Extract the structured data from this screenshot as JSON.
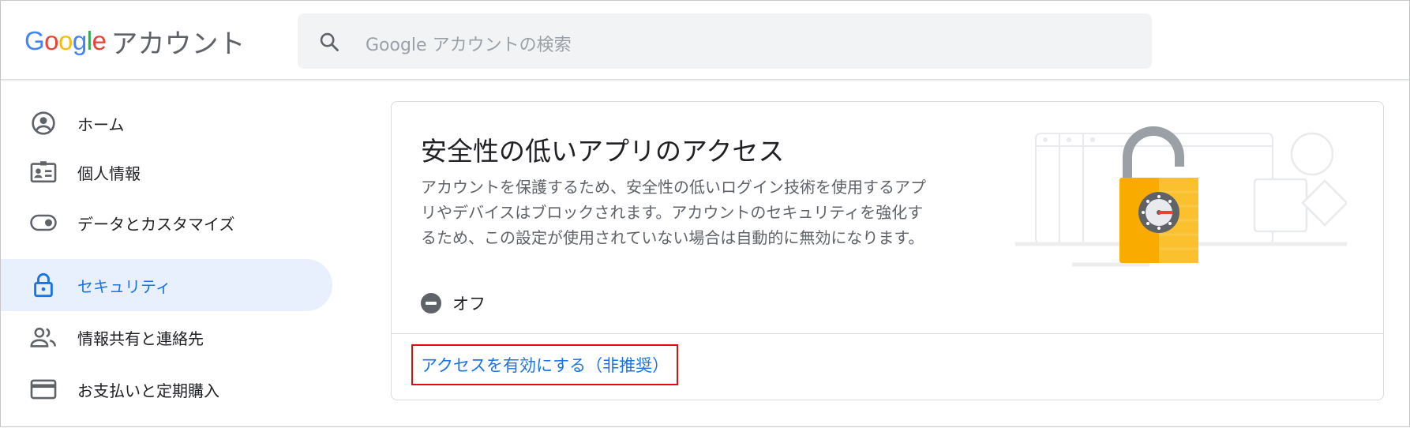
{
  "header": {
    "logo_letters": [
      {
        "char": "G",
        "color": "#4285F4"
      },
      {
        "char": "o",
        "color": "#EA4335"
      },
      {
        "char": "o",
        "color": "#FBBC05"
      },
      {
        "char": "g",
        "color": "#4285F4"
      },
      {
        "char": "l",
        "color": "#34A853"
      },
      {
        "char": "e",
        "color": "#EA4335"
      }
    ],
    "logo_google": "Google",
    "product_name": "アカウント",
    "search_placeholder": "Google アカウントの検索",
    "search_icon": "search-icon"
  },
  "sidebar": {
    "items": [
      {
        "label": "ホーム",
        "icon": "account-circle-icon",
        "active": false
      },
      {
        "label": "個人情報",
        "icon": "id-card-icon",
        "active": false
      },
      {
        "label": "データとカスタマイズ",
        "icon": "toggle-icon",
        "active": false
      },
      {
        "label": "セキュリティ",
        "icon": "lock-icon",
        "active": true
      },
      {
        "label": "情報共有と連絡先",
        "icon": "people-icon",
        "active": false
      },
      {
        "label": "お支払いと定期購入",
        "icon": "credit-card-icon",
        "active": false
      }
    ]
  },
  "card": {
    "title": "安全性の低いアプリのアクセス",
    "description_lines": [
      "アカウントを保護するため、安全性の低いログイン技術を使用するアプ",
      "リやデバイスはブロックされます。アカウントのセキュリティを強化す",
      "るため、この設定が使用されていない場合は自動的に無効になります。"
    ],
    "status_label": "オフ",
    "status_icon": "minus-circle-icon",
    "action_label": "アクセスを有効にする（非推奨）",
    "illustration": "unlocked-padlock-illustration"
  },
  "colors": {
    "accent": "#1a73e8",
    "active_bg": "#e8f0fe",
    "highlight_border": "#e30b0b",
    "padlock": "#f9ab00"
  }
}
